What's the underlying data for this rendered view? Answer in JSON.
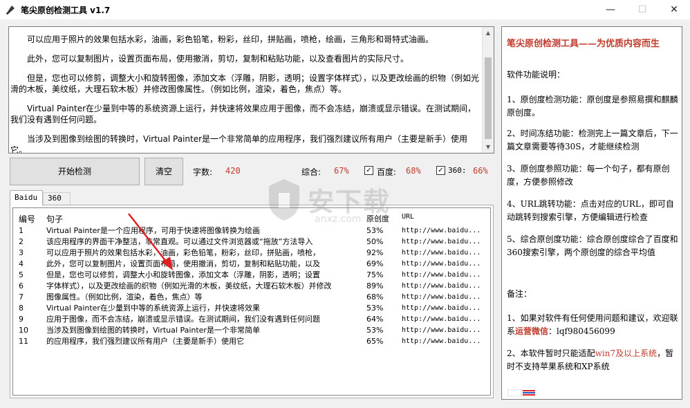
{
  "window": {
    "title": "笔尖原创检测工具 v1.7",
    "minimize": "—",
    "maximize": "☐",
    "close": "✕"
  },
  "editor": {
    "paragraphs": [
      "可以应用于照片的效果包括水彩，油画，彩色铅笔，粉彩，丝印，拼贴画，喷枪，绘画，三角形和哥特式油画。",
      "此外，您可以复制图片，设置页面布局，使用撤消，剪切，复制和粘贴功能，以及查看图片的实际尺寸。",
      "但是，您也可以修剪，调整大小和旋转图像，添加文本（浮雕，阴影，透明；设置字体样式），以及更改绘画的织物（例如光滑的木板，美纹纸，大理石软木板）并修改图像属性。（例如比例，渲染，着色，焦点）等。",
      "Virtual Painter在少量到中等的系统资源上运行，并快速将效果应用于图像，而不会冻结，崩溃或显示错误。在测试期间，我们没有遇到任何问题。",
      "当涉及到图像到绘图的转换时，Virtual Painter是一个非常简单的应用程序，我们强烈建议所有用户（主要是新手）使用它。"
    ]
  },
  "controls": {
    "start_button": "开始检测",
    "clear_button": "清空",
    "word_count_label": "字数:",
    "word_count_value": "420",
    "overall_label": "综合:",
    "overall_value": "67%",
    "baidu_label": "百度:",
    "baidu_value": "68%",
    "so360_label": "360:",
    "so360_value": "66%",
    "baidu_checked": "✓",
    "so360_checked": "✓"
  },
  "tabs": [
    {
      "label": "Baidu"
    },
    {
      "label": "360"
    }
  ],
  "list": {
    "headers": {
      "num": "编号",
      "sentence": "句子",
      "score": "原创度",
      "url": "URL"
    },
    "rows": [
      {
        "num": "1",
        "sentence": "Virtual Painter是一个应用程序，可用于快速将图像转换为绘画",
        "score": "53%",
        "url": "http://www.baidu..."
      },
      {
        "num": "2",
        "sentence": "该应用程序的界面干净整洁，非常直观。可以通过文件浏览器或“拖放”方法导入",
        "score": "50%",
        "url": "http://www.baidu..."
      },
      {
        "num": "3",
        "sentence": "可以应用于照片的效果包括水彩，油画，彩色铅笔，粉彩，丝印，拼贴画，喷枪，",
        "score": "92%",
        "url": "http://www.baidu..."
      },
      {
        "num": "4",
        "sentence": "此外，您可以复制图片，设置页面布局，使用撤消，剪切，复制和粘贴功能，以及",
        "score": "69%",
        "url": "http://www.baidu..."
      },
      {
        "num": "5",
        "sentence": "但是，您也可以修剪，调整大小和旋转图像，添加文本（浮雕，阴影，透明；设置",
        "score": "75%",
        "url": "http://www.baidu..."
      },
      {
        "num": "6",
        "sentence": "字体样式），以及更改绘画的织物（例如光滑的木板，美纹纸，大理石软木板）并修改",
        "score": "89%",
        "url": "http://www.baidu..."
      },
      {
        "num": "7",
        "sentence": "图像属性。（例如比例，渲染，着色，焦点）等",
        "score": "68%",
        "url": "http://www.baidu..."
      },
      {
        "num": "8",
        "sentence": "Virtual Painter在少量到中等的系统资源上运行，并快速将效果",
        "score": "53%",
        "url": "http://www.baidu..."
      },
      {
        "num": "9",
        "sentence": "应用于图像，而不会冻结，崩溃或显示错误。在测试期间，我们没有遇到任何问题",
        "score": "64%",
        "url": "http://www.baidu..."
      },
      {
        "num": "10",
        "sentence": "当涉及到图像到绘图的转换时，Virtual Painter是一个非常简单",
        "score": "53%",
        "url": "http://www.baidu..."
      },
      {
        "num": "11",
        "sentence": "的应用程序，我们强烈建议所有用户（主要是新手）使用它",
        "score": "65%",
        "url": "http://www.baidu..."
      }
    ]
  },
  "watermark": {
    "text": "安下载",
    "sub": "anxz.com"
  },
  "info": {
    "title": "笔尖原创检测工具——为优质内容而生",
    "intro": "软件功能说明：",
    "f1": "1、原创度检测功能：原创度是参照易撰和麒麟原创度。",
    "f2": "2、时间冻结功能：检测完上一篇文章后，下一篇文章需要等待30S，才能继续检测",
    "f3": "3、原创度参照功能：每一个句子，都有原创度，方便参照修改",
    "f4": "4、URL跳转功能：点击对应的URL，即可自动跳转到搜索引擎，方便编辑进行检查",
    "f5": "5、综合原创度功能：综合原创度综合了百度和360搜索引擎，两个原创度的综合平均值",
    "note_title": "备注：",
    "n1_a": "1、如果对软件有任何使用问题和建议，欢迎联系",
    "n1_b": "运营微信",
    "n1_c": "：lqf980456099",
    "n2_a": "2、本软件暂时只能适配",
    "n2_b": "win7及以上系统",
    "n2_c": "，暂时不支持苹果系统和XP系统"
  },
  "colors": {
    "accent_red": "#c0392b",
    "arrow_red": "#e02020"
  }
}
